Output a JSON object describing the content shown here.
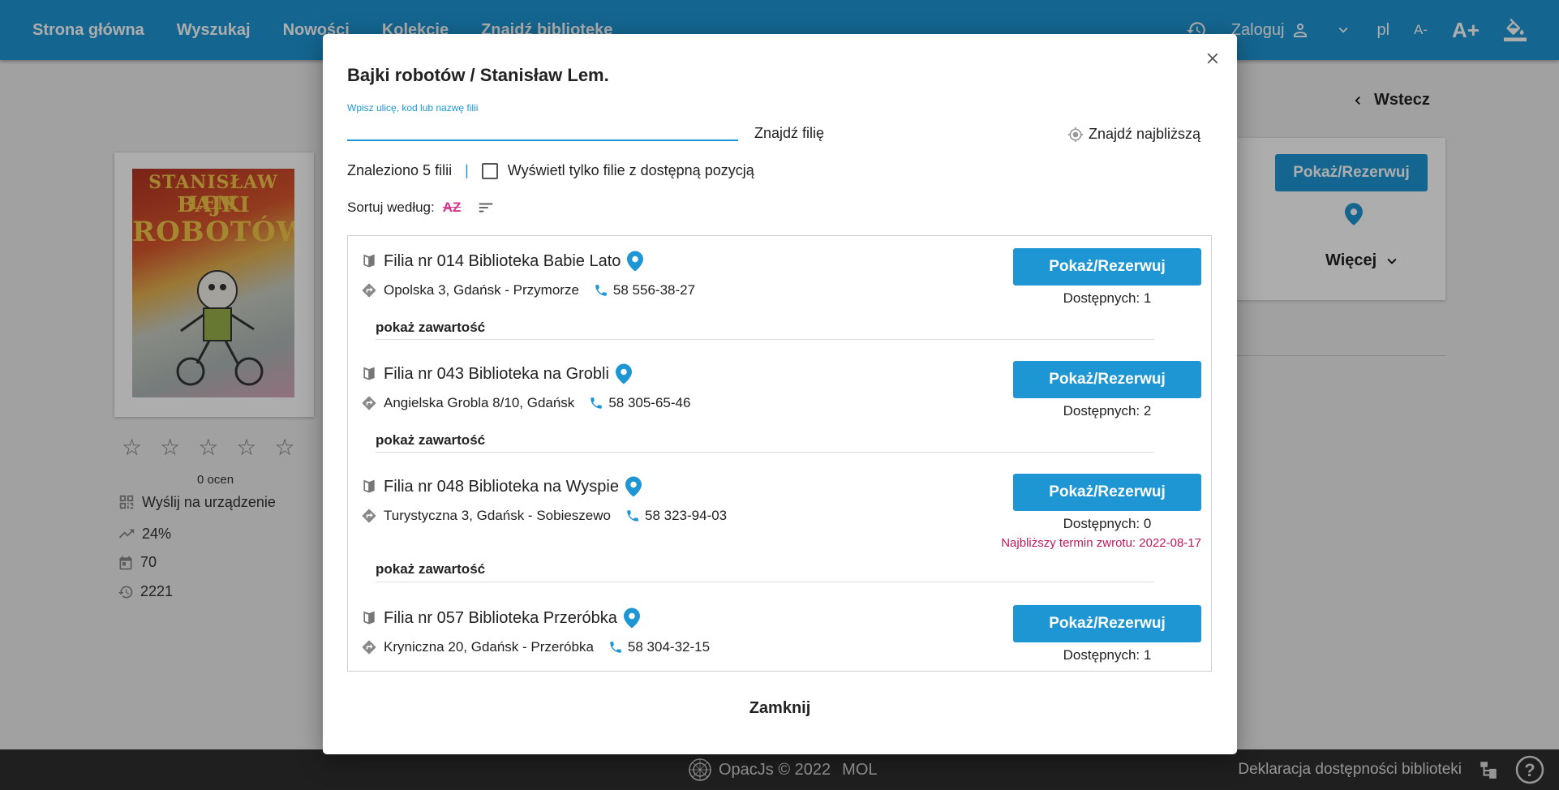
{
  "nav": {
    "items": [
      "Strona główna",
      "Wyszukaj",
      "Nowości",
      "Kolekcje",
      "Znajdź bibliotekę"
    ],
    "login": "Zaloguj",
    "lang": "pl",
    "font_smaller": "A-",
    "font_bigger": "A+"
  },
  "background": {
    "back": "Wstecz",
    "cover_text": [
      "STANISŁAW LEM",
      "BAJKI",
      "ROBOTÓW"
    ],
    "ratings_count": "0 ocen",
    "send_to_device": "Wyślij na urządzenie",
    "stat_trend": "24%",
    "stat_calendar": "70",
    "stat_history": "2221",
    "show_reserve": "Pokaż/Rezerwuj",
    "more": "Więcej"
  },
  "footer": {
    "copyright": "OpacJs © 2022",
    "vendor": "MOL",
    "accessibility": "Deklaracja dostępności biblioteki"
  },
  "modal": {
    "title": "Bajki robotów / Stanisław Lem.",
    "search_label": "Wpisz ulicę, kod lub nazwę filii",
    "search_value": "",
    "find_branch": "Znajdź filię",
    "find_nearest": "Znajdź najbliższą",
    "found_count": "Znaleziono 5 filii",
    "only_available": "Wyświetl tylko filie z dostępną pozycją",
    "sort_label": "Sortuj według:",
    "sort_az": "AZ",
    "show_contents": "pokaż zawartość",
    "close": "Zamknij",
    "branches": [
      {
        "name": "Filia nr 014 Biblioteka Babie Lato",
        "address": "Opolska 3, Gdańsk - Przymorze",
        "phone": "58 556-38-27",
        "button": "Pokaż/Rezerwuj",
        "available": "Dostępnych: 1",
        "return_date": ""
      },
      {
        "name": "Filia nr 043 Biblioteka na Grobli",
        "address": "Angielska Grobla 8/10, Gdańsk",
        "phone": "58 305-65-46",
        "button": "Pokaż/Rezerwuj",
        "available": "Dostępnych: 2",
        "return_date": ""
      },
      {
        "name": "Filia nr 048 Biblioteka na Wyspie",
        "address": "Turystyczna 3, Gdańsk - Sobieszewo",
        "phone": "58 323-94-03",
        "button": "Pokaż/Rezerwuj",
        "available": "Dostępnych: 0",
        "return_date": "Najbliższy termin zwrotu: 2022-08-17"
      },
      {
        "name": "Filia nr 057 Biblioteka Przeróbka",
        "address": "Kryniczna 20, Gdańsk - Przeróbka",
        "phone": "58 304-32-15",
        "button": "Pokaż/Rezerwuj",
        "available": "Dostępnych: 1",
        "return_date": ""
      }
    ]
  },
  "colors": {
    "primary": "#1e96d4",
    "accent": "#d6338a",
    "return_text": "#c2185b",
    "footer_bg": "#2f2f2f"
  }
}
